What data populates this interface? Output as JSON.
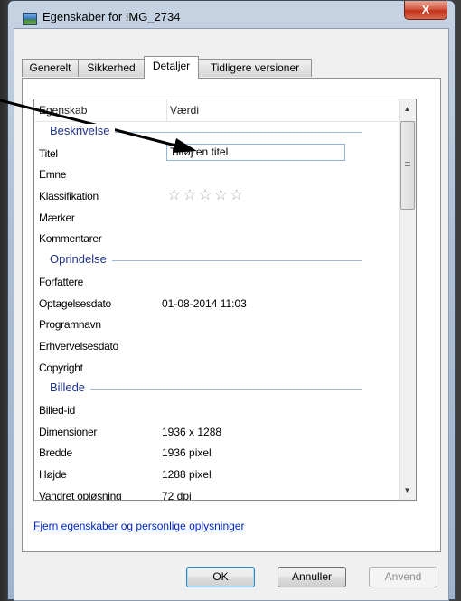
{
  "window": {
    "title": "Egenskaber for IMG_2734",
    "close_label": "X"
  },
  "tabs": [
    {
      "label": "Generelt"
    },
    {
      "label": "Sikkerhed"
    },
    {
      "label": "Detaljer"
    },
    {
      "label": "Tidligere versioner"
    }
  ],
  "list": {
    "col_property": "Egenskab",
    "col_value": "Værdi",
    "groups": {
      "description": "Beskrivelse",
      "origin": "Oprindelse",
      "image": "Billede"
    },
    "rows": {
      "title": {
        "label": "Titel",
        "value": "Tilføj en titel"
      },
      "subject": {
        "label": "Emne"
      },
      "rating": {
        "label": "Klassifikation",
        "stars": "☆☆☆☆☆"
      },
      "tags": {
        "label": "Mærker"
      },
      "comments": {
        "label": "Kommentarer"
      },
      "authors": {
        "label": "Forfattere"
      },
      "date_taken": {
        "label": "Optagelsesdato",
        "value": "01-08-2014 11:03"
      },
      "program": {
        "label": "Programnavn"
      },
      "acquired": {
        "label": "Erhvervelsesdato"
      },
      "copyright": {
        "label": "Copyright"
      },
      "image_id": {
        "label": "Billed-id"
      },
      "dimensions": {
        "label": "Dimensioner",
        "value": "1936 x 1288"
      },
      "width": {
        "label": "Bredde",
        "value": "1936 pixel"
      },
      "height": {
        "label": "Højde",
        "value": "1288 pixel"
      },
      "hres": {
        "label": "Vandret opløsning",
        "value": "72 dpi"
      }
    }
  },
  "remove_link": "Fjern egenskaber og personlige oplysninger",
  "buttons": {
    "ok": "OK",
    "cancel": "Annuller",
    "apply": "Anvend"
  }
}
